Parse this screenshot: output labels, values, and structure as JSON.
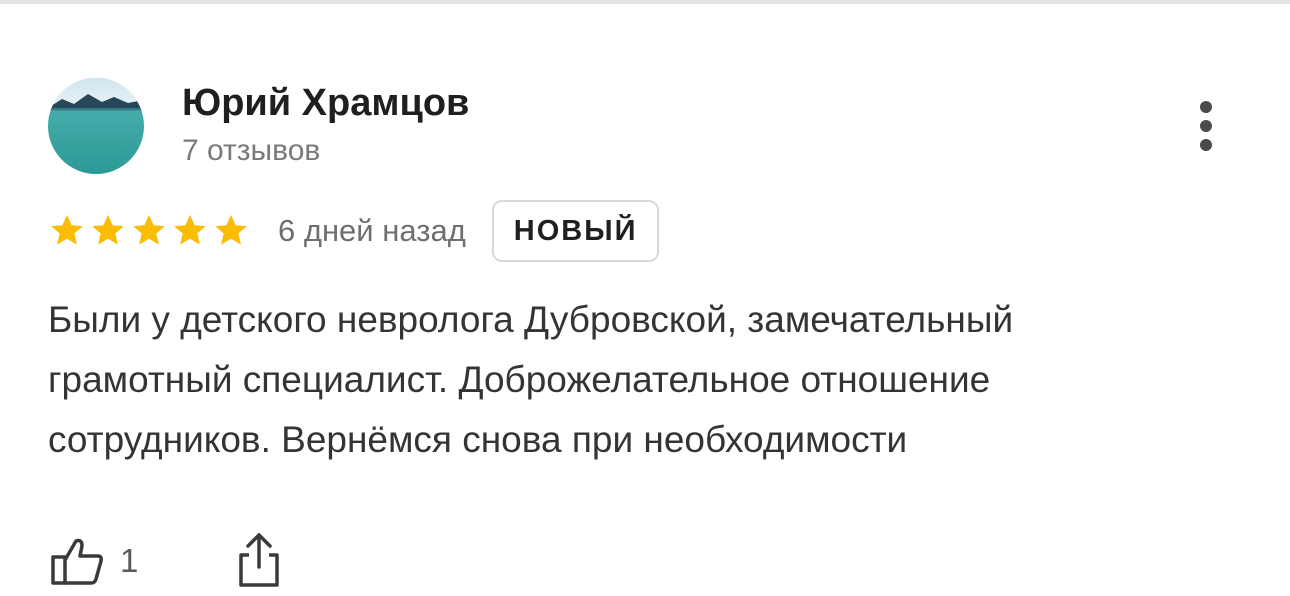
{
  "review": {
    "author": {
      "name": "Юрий Храмцов",
      "reviews_count": "7 отзывов",
      "avatar": "lake-landscape-photo"
    },
    "rating": 5,
    "max_rating": 5,
    "date": "6 дней назад",
    "badge": "НОВЫЙ",
    "text_lines": [
      "Были у детского невролога Дубровской, замечательный",
      "грамотный специалист. Доброжелательное отношение",
      "сотрудников. Вернёмся снова при необходимости"
    ],
    "likes": "1"
  },
  "icons": {
    "more": "more-vertical-icon",
    "like": "thumbs-up-icon",
    "share": "share-icon",
    "star": "star-icon"
  },
  "colors": {
    "star": "#fbbc04",
    "badge_border": "#d9d9d9",
    "secondary_text": "#7a7a7a"
  }
}
